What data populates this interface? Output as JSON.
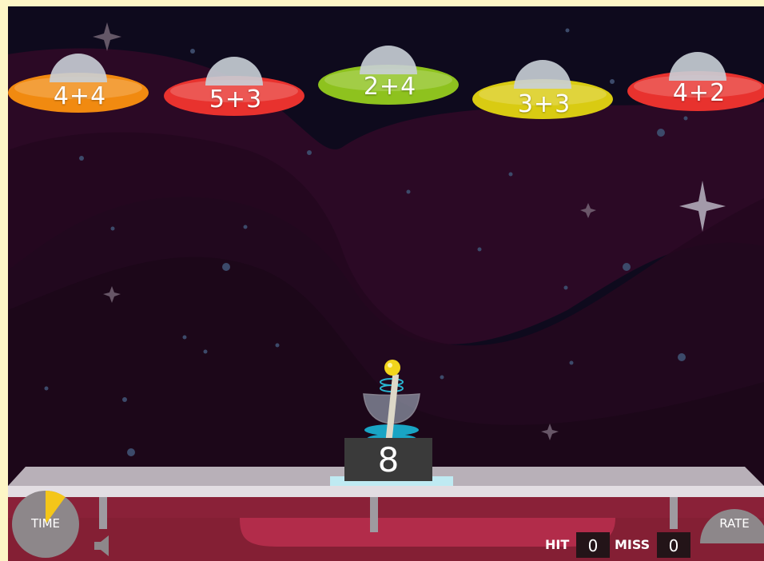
{
  "ufos": [
    {
      "equation": "4+4",
      "color": "#f18a10",
      "dome": "#c9cfd7"
    },
    {
      "equation": "5+3",
      "color": "#e8322e",
      "dome": "#c9cfd7"
    },
    {
      "equation": "2+4",
      "color": "#8ec21e",
      "dome": "#c9cfd7"
    },
    {
      "equation": "3+3",
      "color": "#d9cb12",
      "dome": "#c9cfd7"
    },
    {
      "equation": "4+2",
      "color": "#e8322e",
      "dome": "#c9cfd7"
    }
  ],
  "target_number": "8",
  "time": {
    "label": "TIME",
    "elapsed_fraction": 0.1
  },
  "rate": {
    "label": "RATE"
  },
  "score": {
    "hit_label": "HIT",
    "hit_value": "0",
    "miss_label": "MISS",
    "miss_value": "0"
  },
  "icons": {
    "sound": "speaker-icon"
  },
  "colors": {
    "space": "#0e0a1d",
    "nebula": "#3a0f2c",
    "floor": "#c8284f",
    "frame": "#fdf6c6"
  }
}
